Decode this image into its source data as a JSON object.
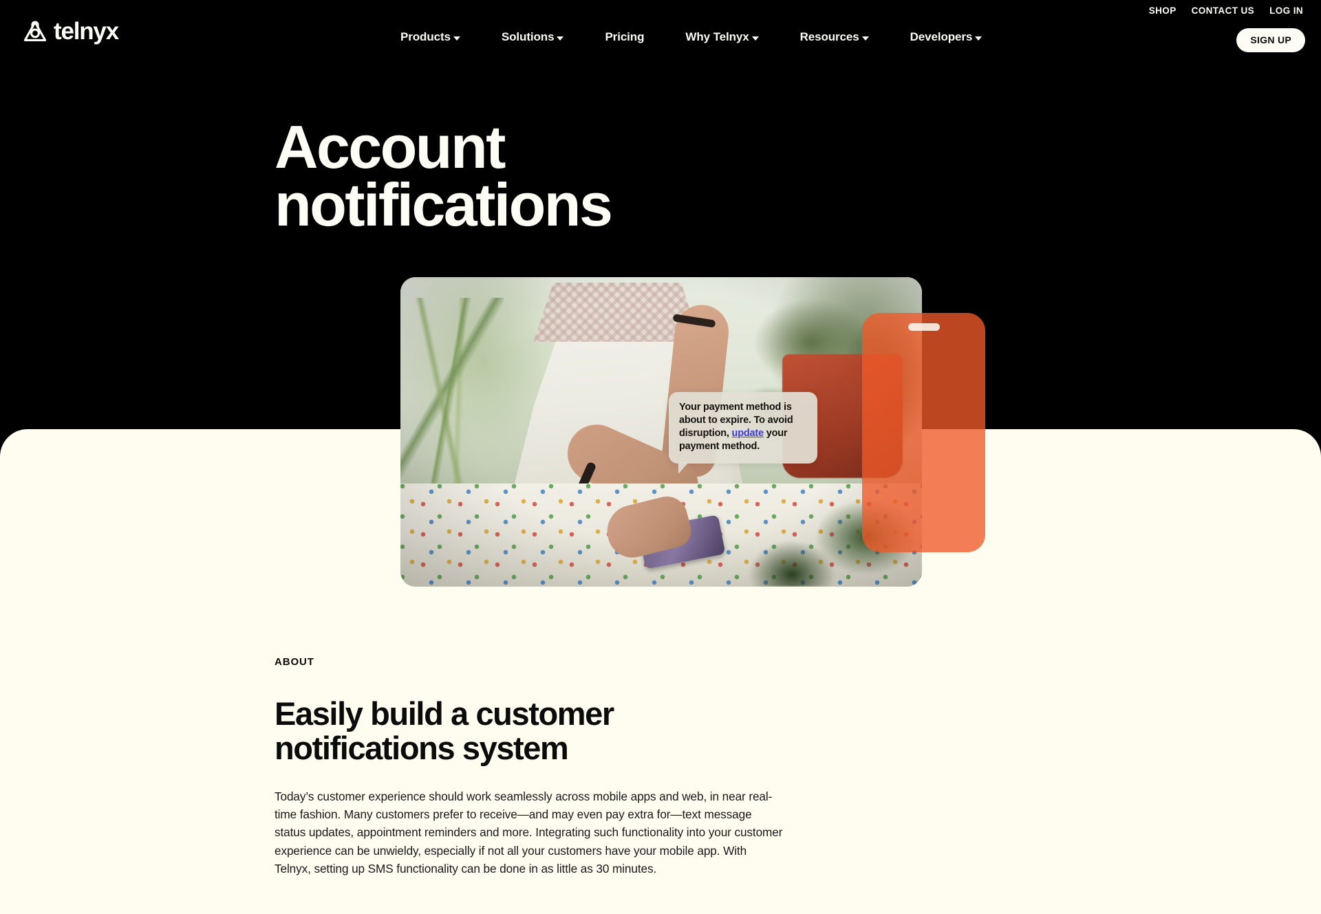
{
  "site": {
    "brand_name": "telnyx",
    "brand_mark_icon": "telnyx-logo-icon"
  },
  "utility_nav": {
    "items": [
      {
        "label": "SHOP"
      },
      {
        "label": "CONTACT US"
      },
      {
        "label": "LOG IN"
      }
    ],
    "signup_label": "SIGN UP"
  },
  "main_nav": {
    "items": [
      {
        "label": "Products",
        "has_dropdown": true
      },
      {
        "label": "Solutions",
        "has_dropdown": true
      },
      {
        "label": "Pricing",
        "has_dropdown": false
      },
      {
        "label": "Why Telnyx",
        "has_dropdown": true
      },
      {
        "label": "Resources",
        "has_dropdown": true
      },
      {
        "label": "Developers",
        "has_dropdown": true
      }
    ]
  },
  "hero": {
    "title": "Account\nnotifications",
    "sms": {
      "text_before_link": "Your payment method is about to expire. To avoid disruption, ",
      "link_text": "update",
      "text_after_link": " your payment method."
    }
  },
  "about": {
    "eyebrow": "ABOUT",
    "title": "Easily build a customer\nnotifications system",
    "body": "Today’s customer experience should work seamlessly across mobile apps and web, in near real-time fashion. Many customers prefer to receive—and may even pay extra for—text message status updates, appointment reminders and more. Integrating such functionality into your customer experience can be unwieldy, especially if not all your customers have your mobile app. With Telnyx, setting up SMS functionality can be done in as little as 30 minutes."
  },
  "colors": {
    "background_dark": "#000000",
    "cream_panel": "#FFFDF0",
    "text_cream": "#FDFDF5",
    "text_dark": "#0B0B0B",
    "phone_orange": "#F05A29",
    "sms_bubble": "#E2DFD4",
    "link_blue": "#3B3BD6"
  }
}
